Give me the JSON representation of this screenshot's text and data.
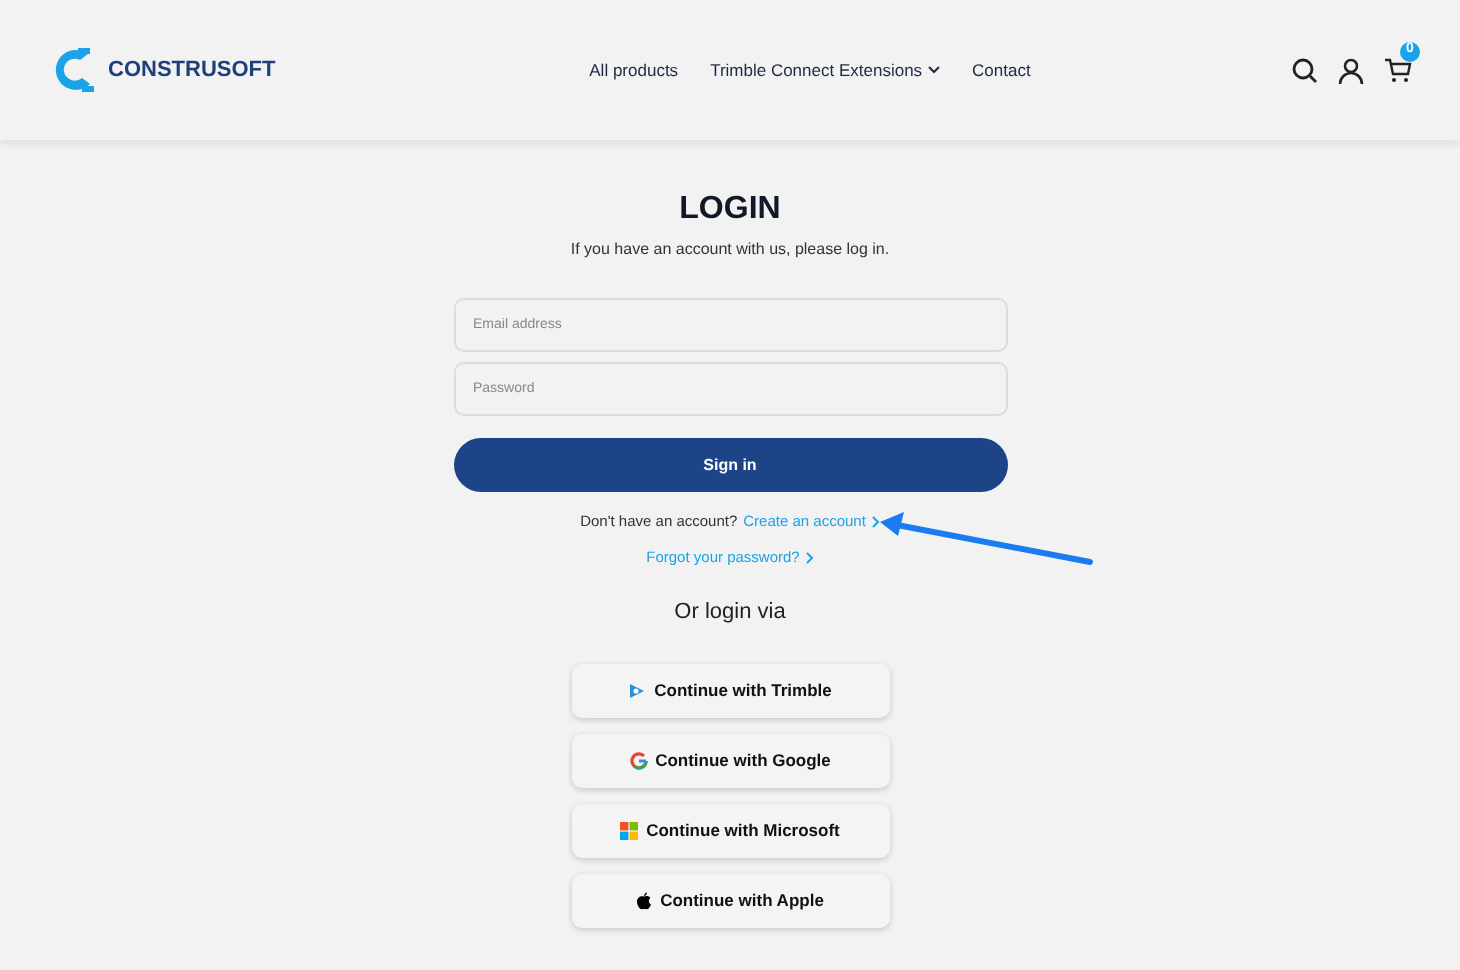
{
  "header": {
    "brand": "CONSTRUSOFT",
    "nav": [
      {
        "label": "All products",
        "dropdown": false
      },
      {
        "label": "Trimble Connect Extensions",
        "dropdown": true
      },
      {
        "label": "Contact",
        "dropdown": false
      }
    ],
    "cart_count": "0"
  },
  "login": {
    "title": "LOGIN",
    "subtitle": "If you have an account with us, please log in.",
    "email": {
      "placeholder": "Email address"
    },
    "password": {
      "placeholder": "Password"
    },
    "submit": "Sign in",
    "signup_prompt": "Don't have an account?",
    "signup_link": "Create an account",
    "forgot_link": "Forgot your password?",
    "alt_heading": "Or login via",
    "providers": [
      {
        "kind": "trimble",
        "label": "Continue with Trimble"
      },
      {
        "kind": "google",
        "label": "Continue with Google"
      },
      {
        "kind": "microsoft",
        "label": "Continue with Microsoft"
      },
      {
        "kind": "apple",
        "label": "Continue with Apple"
      }
    ]
  }
}
